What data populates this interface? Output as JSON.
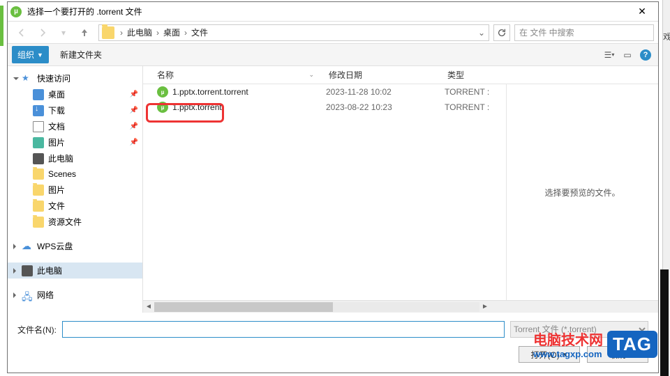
{
  "title": "选择一个要打开的 .torrent 文件",
  "breadcrumb": {
    "root": "此电脑",
    "mid": "桌面",
    "leaf": "文件"
  },
  "search": {
    "placeholder": "在 文件 中搜索"
  },
  "toolbar": {
    "organize": "组织",
    "new_folder": "新建文件夹"
  },
  "columns": {
    "name": "名称",
    "date": "修改日期",
    "type": "类型"
  },
  "files": [
    {
      "name": "1.pptx.torrent.torrent",
      "date": "2023-11-28 10:02",
      "type": "TORRENT :"
    },
    {
      "name": "1.pptx.torrent",
      "date": "2023-08-22 10:23",
      "type": "TORRENT :"
    }
  ],
  "sidebar": {
    "quick": "快速访问",
    "desktop": "桌面",
    "downloads": "下载",
    "documents": "文档",
    "pictures": "图片",
    "thispc_q": "此电脑",
    "scenes": "Scenes",
    "pictures2": "图片",
    "files": "文件",
    "resources": "资源文件",
    "wps": "WPS云盘",
    "thispc": "此电脑",
    "network": "网络"
  },
  "preview": {
    "empty": "选择要预览的文件。"
  },
  "footer": {
    "label": "文件名(N):",
    "filter": "Torrent 文件 (*.torrent)",
    "open": "打开(O)",
    "cancel": "取消"
  },
  "watermark": {
    "cn": "电脑技术网",
    "url": "www.tagxp.com",
    "badge": "TAG"
  },
  "right_edge_char": "戏"
}
